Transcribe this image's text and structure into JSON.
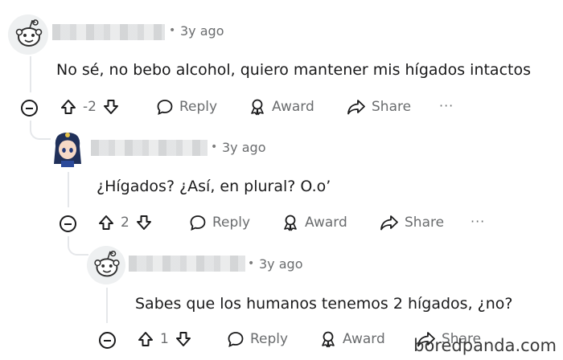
{
  "comments": [
    {
      "time": "3y ago",
      "dot": "•",
      "text": "No sé, no bebo alcohol, quiero mantener mis hígados intactos",
      "vote_count": "-2",
      "reply_label": "Reply",
      "award_label": "Award",
      "share_label": "Share",
      "more_label": "···",
      "avatar_icon": "snoo-avatar-icon"
    },
    {
      "time": "3y ago",
      "dot": "•",
      "text": "¿Hígados? ¿Así, en plural? O.o’",
      "vote_count": "2",
      "reply_label": "Reply",
      "award_label": "Award",
      "share_label": "Share",
      "more_label": "···",
      "avatar_icon": "anime-avatar-icon"
    },
    {
      "time": "3y ago",
      "dot": "•",
      "text": "Sabes que los humanos tenemos 2 hígados, ¿no?",
      "vote_count": "1",
      "reply_label": "Reply",
      "award_label": "Award",
      "share_label": "Share",
      "more_label": "",
      "avatar_icon": "snoo-avatar-icon"
    }
  ],
  "watermark": "boredpanda.com",
  "colors": {
    "text": "#1a1a1b",
    "meta": "#6a6c6e",
    "thread": "#e5e7ea"
  }
}
